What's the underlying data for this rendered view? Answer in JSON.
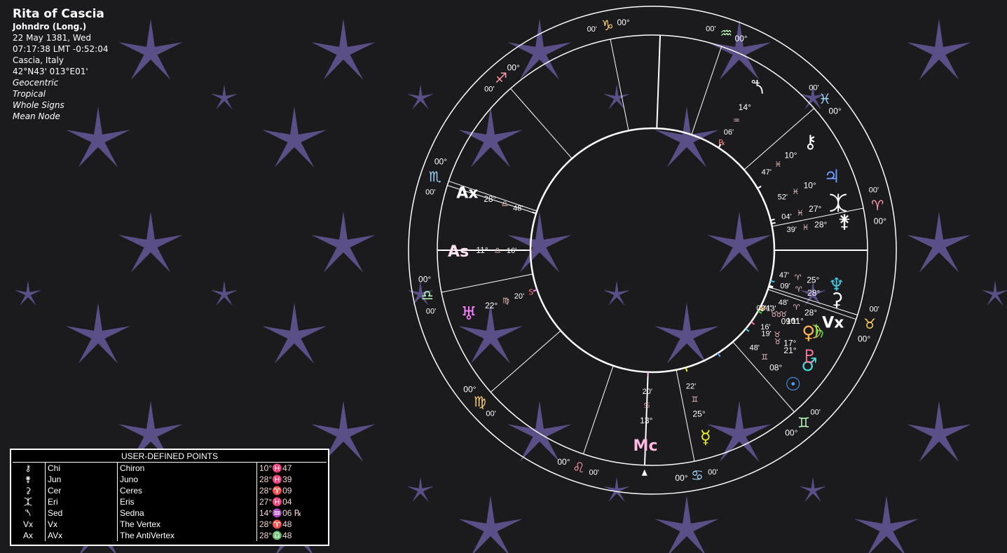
{
  "header": {
    "title": "Rita of Cascia",
    "house_system": "Johndro (Long.)",
    "date": "22 May 1381, Wed",
    "time": "07:17:38  LMT -0:52:04",
    "place": "Cascia, Italy",
    "coords": "42°N43' 013°E01'",
    "options": [
      "Geocentric",
      "Tropical",
      "Whole Signs",
      "Mean Node"
    ]
  },
  "colors": {
    "background": "#1b1b1d",
    "star": "#5a4f86",
    "fire": "#ff9aa8",
    "earth": "#ffd070",
    "air": "#b8ffb8",
    "water": "#a0d8ff"
  },
  "chart": {
    "cusp_labels": [
      {
        "sign": "♋",
        "deg": "00°",
        "min": "00'"
      },
      {
        "sign": "♊",
        "deg": "00°",
        "min": "00'"
      },
      {
        "sign": "♉",
        "deg": "00°",
        "min": "00'"
      },
      {
        "sign": "♈",
        "deg": "00°",
        "min": "00'"
      },
      {
        "sign": "♓",
        "deg": "00°",
        "min": "00'"
      },
      {
        "sign": "♒",
        "deg": "00°",
        "min": "00'"
      },
      {
        "sign": "♑",
        "deg": "00°",
        "min": "00'"
      },
      {
        "sign": "♐",
        "deg": "00°",
        "min": "00'"
      },
      {
        "sign": "♏",
        "deg": "00°",
        "min": "00'"
      },
      {
        "sign": "♎",
        "deg": "00°",
        "min": "00'"
      },
      {
        "sign": "♍",
        "deg": "00°",
        "min": "00'"
      },
      {
        "sign": "♌",
        "deg": "00°",
        "min": "00'"
      }
    ],
    "points": [
      {
        "name": "mc",
        "glyph": "Mc",
        "deg": "13°",
        "sign": "♋",
        "min": "20'"
      },
      {
        "name": "mercury",
        "glyph": "☿",
        "deg": "25°",
        "sign": "♊",
        "min": "22'"
      },
      {
        "name": "sun",
        "glyph": "☉",
        "deg": "08°",
        "sign": "♊",
        "min": "48'"
      },
      {
        "name": "mars",
        "glyph": "♂",
        "deg": "21°",
        "sign": "♉",
        "min": "19'"
      },
      {
        "name": "pluto",
        "glyph": "♇",
        "deg": "17°",
        "sign": "♉",
        "min": "16'"
      },
      {
        "name": "saturn",
        "glyph": "♄",
        "deg": "11°",
        "sign": "♉",
        "min": "13'"
      },
      {
        "name": "moon",
        "glyph": "☽",
        "deg": "10°",
        "sign": "♉",
        "min": "04'"
      },
      {
        "name": "venus",
        "glyph": "♀",
        "deg": "09°",
        "sign": "♉",
        "min": "02'"
      },
      {
        "name": "vertex",
        "glyph": "Vx",
        "deg": "28°",
        "sign": "♈",
        "min": "48'"
      },
      {
        "name": "ceres",
        "glyph": "⚳",
        "deg": "28°",
        "sign": "♈",
        "min": "09'"
      },
      {
        "name": "neptune",
        "glyph": "♆",
        "deg": "25°",
        "sign": "♈",
        "min": "47'"
      },
      {
        "name": "juno",
        "glyph": "⚵",
        "deg": "28°",
        "sign": "♓",
        "min": "39'"
      },
      {
        "name": "eris",
        "glyph": "⯰",
        "deg": "27°",
        "sign": "♓",
        "min": "04'"
      },
      {
        "name": "jupiter",
        "glyph": "♃",
        "deg": "10°",
        "sign": "♓",
        "min": "52'"
      },
      {
        "name": "chiron",
        "glyph": "⚷",
        "deg": "10°",
        "sign": "♓",
        "min": "47'"
      },
      {
        "name": "sedna",
        "glyph": "⯲",
        "deg": "14°",
        "sign": "♒",
        "min": "06'",
        "retro": "℞"
      },
      {
        "name": "antivertex",
        "glyph": "Ax",
        "deg": "28°",
        "sign": "♎",
        "min": "48'"
      },
      {
        "name": "ascendant",
        "glyph": "As",
        "deg": "11°",
        "sign": "♎",
        "min": "16'"
      },
      {
        "name": "uranus",
        "glyph": "♅",
        "deg": "22°",
        "sign": "♍",
        "min": "20'",
        "retro": "S"
      }
    ]
  },
  "user_points": {
    "title": "USER-DEFINED POINTS",
    "rows": [
      {
        "glyph": "⚷",
        "abbr": "Chi",
        "name": "Chiron",
        "pos": "10°♓47"
      },
      {
        "glyph": "⚵",
        "abbr": "Jun",
        "name": "Juno",
        "pos": "28°♓39"
      },
      {
        "glyph": "⚳",
        "abbr": "Cer",
        "name": "Ceres",
        "pos": "28°♈09"
      },
      {
        "glyph": "⯰",
        "abbr": "Eri",
        "name": "Eris",
        "pos": "27°♓04"
      },
      {
        "glyph": "⯲",
        "abbr": "Sed",
        "name": "Sedna",
        "pos": "14°♒06 ℞"
      },
      {
        "glyph": "Vx",
        "abbr": "Vx",
        "name": "The Vertex",
        "pos": "28°♈48"
      },
      {
        "glyph": "Ax",
        "abbr": "AVx",
        "name": "The AntiVertex",
        "pos": "28°♎48"
      }
    ]
  }
}
